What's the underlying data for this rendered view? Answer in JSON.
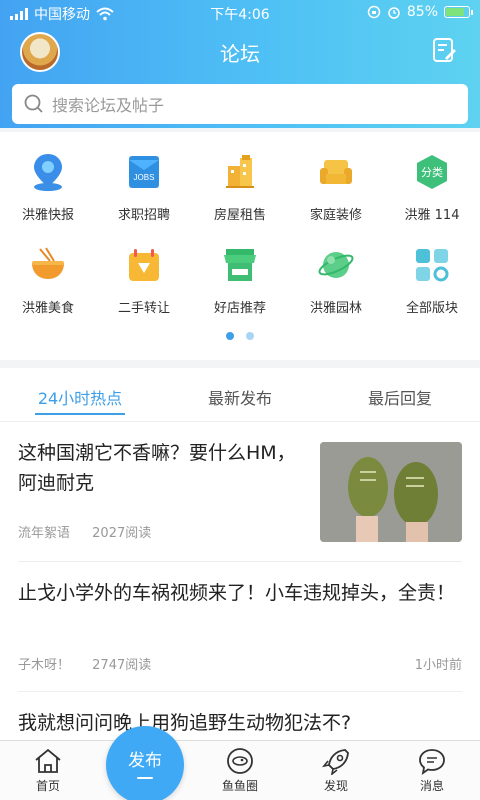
{
  "status_bar": {
    "carrier": "中国移动",
    "time": "下午4:06",
    "battery": "85%",
    "battery_level": 0.85
  },
  "navbar": {
    "title": "论坛"
  },
  "search": {
    "placeholder": "搜索论坛及帖子"
  },
  "categories": [
    {
      "label": "洪雅快报",
      "icon": "location-pin-icon"
    },
    {
      "label": "求职招聘",
      "icon": "jobs-book-icon"
    },
    {
      "label": "房屋租售",
      "icon": "building-icon"
    },
    {
      "label": "家庭装修",
      "icon": "sofa-icon"
    },
    {
      "label": "洪雅 114",
      "icon": "classify-bubble-icon"
    },
    {
      "label": "洪雅美食",
      "icon": "noodle-bowl-icon"
    },
    {
      "label": "二手转让",
      "icon": "gift-bag-icon"
    },
    {
      "label": "好店推荐",
      "icon": "shop-awning-icon"
    },
    {
      "label": "洪雅园林",
      "icon": "planet-icon"
    },
    {
      "label": "全部版块",
      "icon": "grid-blocks-icon"
    }
  ],
  "pager": {
    "total": 2,
    "active_index": 0
  },
  "tabs": [
    {
      "label": "24小时热点",
      "active": true
    },
    {
      "label": "最新发布",
      "active": false
    },
    {
      "label": "最后回复",
      "active": false
    }
  ],
  "posts": [
    {
      "title": "这种国潮它不香嘛？要什么HM，阿迪耐克",
      "author": "流年絮语",
      "reads": "2027阅读",
      "time": ""
    },
    {
      "title": "止戈小学外的车祸视频来了！小车违规掉头，全责！",
      "author": "子木呀！",
      "reads": "2747阅读",
      "time": "1小时前"
    },
    {
      "title": "我就想问问晚上用狗追野生动物犯法不?",
      "author": "",
      "reads": "",
      "time": ""
    }
  ],
  "tabbar": {
    "home": "首页",
    "publish": "发布",
    "fish": "鱼鱼圈",
    "discover": "发现",
    "messages": "消息"
  },
  "colors": {
    "accent": "#3d9fe8",
    "header_start": "#43a3f2",
    "header_end": "#5ed2f0"
  }
}
